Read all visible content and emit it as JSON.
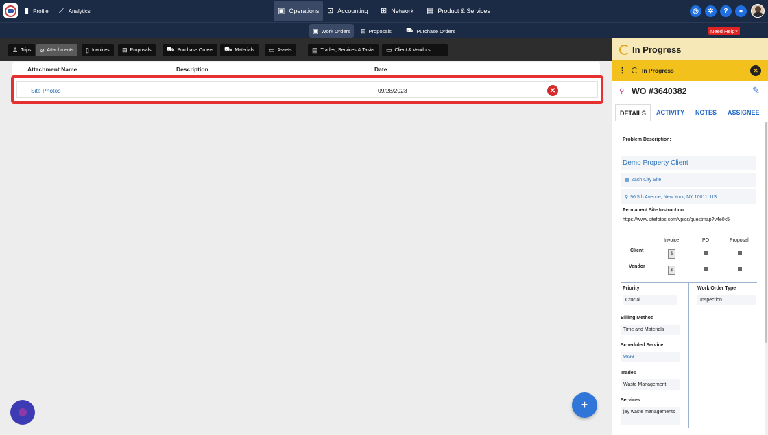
{
  "topnav": {
    "profile": "Profile",
    "analytics": "Analytics",
    "operations": "Operations",
    "accounting": "Accounting",
    "network": "Network",
    "products": "Product & Services"
  },
  "subnav": {
    "work_orders": "Work Orders",
    "proposals": "Proposals",
    "purchase_orders": "Purchase Orders",
    "need_help": "Need Help?"
  },
  "tabs": [
    {
      "label": "Trips"
    },
    {
      "label": "Attachments"
    },
    {
      "label": "Invoices"
    },
    {
      "label": "Proposals"
    },
    {
      "label": "Purchase Orders"
    },
    {
      "label": "Materials"
    },
    {
      "label": "Assets"
    },
    {
      "label": "Trades, Services & Tasks"
    },
    {
      "label": "Client & Vendors"
    }
  ],
  "table": {
    "headers": [
      "Attachment Name",
      "Description",
      "Date"
    ],
    "rows": [
      {
        "name": "Site Photos",
        "description": "",
        "date": "09/28/2023"
      }
    ]
  },
  "panel": {
    "status_header": "In Progress",
    "status_bar": "In Progress",
    "wo_number": "WO #3640382",
    "tabs": [
      "DETAILS",
      "ACTIVITY",
      "NOTES",
      "ASSIGNEE"
    ],
    "problem_label": "Problem Description:",
    "client_name": "Demo Property Client",
    "site_name": "Zach City Site",
    "address": "96 5th Avenue, New York, NY 10011, US",
    "permanent_label": "Permanent Site Instruction",
    "permanent_url": "https://www.sitefotos.com/vpics/guestmap?v4e0k5",
    "grid": {
      "col_invoice": "Invoice",
      "col_po": "PO",
      "col_proposal": "Proposal",
      "row_client": "Client",
      "row_vendor": "Vendor",
      "doc_glyph": "$"
    },
    "priority_label": "Priority",
    "priority_value": "Crucial",
    "wo_type_label": "Work Order Type",
    "wo_type_value": "Inspection",
    "billing_label": "Billing Method",
    "billing_value": "Time and Materials",
    "scheduled_label": "Scheduled Service",
    "scheduled_value": "9899",
    "trades_label": "Trades",
    "trades_value": "Waste Management",
    "services_label": "Services",
    "services_value": "jay waste managements"
  },
  "colors": {
    "nav_bg": "#1c2b45",
    "status_yellow": "#f2c11b",
    "status_light": "#f7e8b8",
    "highlight_red": "#e53030",
    "link_blue": "#2e73b8",
    "fab_blue": "#2f76d8"
  },
  "icons": {
    "profile": "file-icon",
    "analytics": "chart-icon",
    "operations": "clipboard-icon",
    "accounting": "inbox-icon",
    "network": "network-icon",
    "products": "briefcase-icon",
    "delete": "close-circle-icon",
    "fab": "plus-icon",
    "edit": "pencil-icon"
  }
}
